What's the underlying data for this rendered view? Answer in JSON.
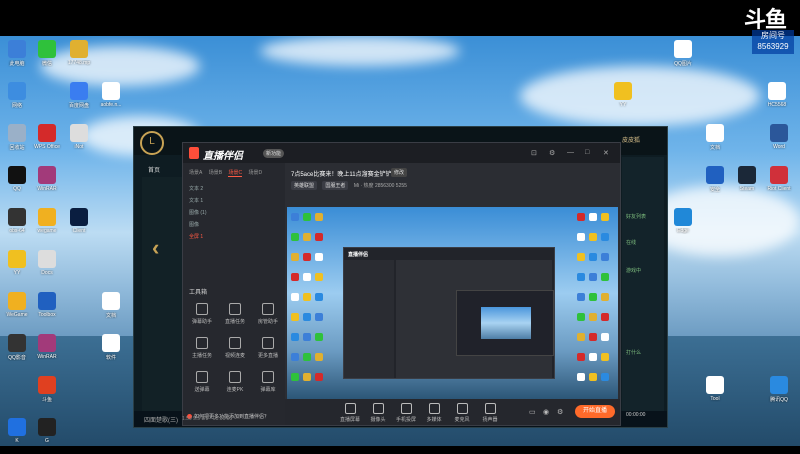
{
  "watermark": {
    "logo": "斗鱼",
    "room_label": "房间号",
    "room_number": "8563929"
  },
  "desktop_icons": [
    {
      "label": "此电脑",
      "color": "#3c7fd8"
    },
    {
      "label": "微信",
      "color": "#2fc13b"
    },
    {
      "label": "17748.mp",
      "color": "#e0b030"
    },
    {
      "label": "网络",
      "color": "#3d8de0"
    },
    {
      "label": "百度网盘",
      "color": "#3a7df0"
    },
    {
      "label": "aobfe.n...",
      "color": "#ffffff"
    },
    {
      "label": "回收站",
      "color": "#9ab0c8"
    },
    {
      "label": "WPS Office",
      "color": "#d42a2a"
    },
    {
      "label": "iNot",
      "color": "#dddddd"
    },
    {
      "label": "QQ",
      "color": "#111111"
    },
    {
      "label": "WinRAR",
      "color": "#a23a7a"
    },
    {
      "label": "obs-64",
      "color": "#333333"
    },
    {
      "label": "wegame",
      "color": "#f0b020"
    },
    {
      "label": "Client",
      "color": "#0a1e40"
    },
    {
      "label": "YY",
      "color": "#f0c020"
    },
    {
      "label": "Docs",
      "color": "#dddddd"
    },
    {
      "label": "WeGame",
      "color": "#f0b020"
    },
    {
      "label": "Toolbox",
      "color": "#2060c0"
    },
    {
      "label": "文档",
      "color": "#ffffff"
    },
    {
      "label": "QQ影音",
      "color": "#333333"
    },
    {
      "label": "WinRAR",
      "color": "#a23a7a"
    },
    {
      "label": "软件",
      "color": "#ffffff"
    },
    {
      "label": "斗鱼",
      "color": "#e04020"
    },
    {
      "label": "K",
      "color": "#2070e0"
    },
    {
      "label": "G",
      "color": "#222222"
    }
  ],
  "right_icons": [
    {
      "label": "QQ图片",
      "color": "#ffffff"
    },
    {
      "label": "HC5568",
      "color": "#ffffff"
    },
    {
      "label": "YY",
      "color": "#f0c020"
    },
    {
      "label": "文档",
      "color": "#ffffff"
    },
    {
      "label": "Steam",
      "color": "#1b2838"
    },
    {
      "label": "Riot Client",
      "color": "#d0303a"
    },
    {
      "label": "Edge",
      "color": "#2088d8"
    },
    {
      "label": "Word",
      "color": "#2b579a"
    },
    {
      "label": "安全",
      "color": "#2060c0"
    },
    {
      "label": "腾讯QQ",
      "color": "#2a8ae0"
    },
    {
      "label": "Tool",
      "color": "#ffffff"
    }
  ],
  "game_window": {
    "logo": "L",
    "nav_home": "首页",
    "username": "皮皮狐",
    "bottom_text": "四面楚歌(三)",
    "right_labels": [
      "好友列表",
      "在线",
      "游戏中",
      "打什么"
    ]
  },
  "stream_app": {
    "logo": "直播伴侣",
    "badge": "新功能",
    "window_controls": [
      "⊡",
      "⚙",
      "—",
      "□",
      "✕"
    ],
    "tabs": [
      "场景A",
      "场景B",
      "场景C",
      "场景D"
    ],
    "active_tab_index": 2,
    "scenes": [
      {
        "name": "文本 2",
        "active": false
      },
      {
        "name": "文本 1",
        "active": false
      },
      {
        "name": "图像 (1)",
        "active": false
      },
      {
        "name": "图像",
        "active": false
      },
      {
        "name": "全屏 1",
        "active": true
      }
    ],
    "toolbox_title": "工具箱",
    "tools": [
      {
        "label": "弹幕助手"
      },
      {
        "label": "直播任务"
      },
      {
        "label": "房管助手"
      },
      {
        "label": "主播任务"
      },
      {
        "label": "视频连麦"
      },
      {
        "label": "更多直播"
      },
      {
        "label": "送弹幕"
      },
      {
        "label": "连麦PK"
      },
      {
        "label": "弹幕库"
      }
    ],
    "tip": "如何把更多功能添加到直播伴侣？",
    "room_title": "7点5ace比赛来！晚上11点溜赛金铲铲！",
    "room_edit_btn": "修改",
    "categories": [
      "英雄联盟",
      "国服王者"
    ],
    "room_meta": [
      "Mi · 热度",
      "2856300",
      "5255"
    ],
    "controls": [
      {
        "label": "直播屏幕"
      },
      {
        "label": "摄像头"
      },
      {
        "label": "手机投屏"
      },
      {
        "label": "多媒体"
      },
      {
        "label": "麦克风"
      },
      {
        "label": "扬声器"
      }
    ],
    "mini_controls": [
      "▭",
      "◉",
      "⚙"
    ],
    "start_button": "开始直播",
    "status_text": "1.59 5.5 8/3 · 00:00:00"
  },
  "tray": {
    "time": "00:00:00"
  }
}
